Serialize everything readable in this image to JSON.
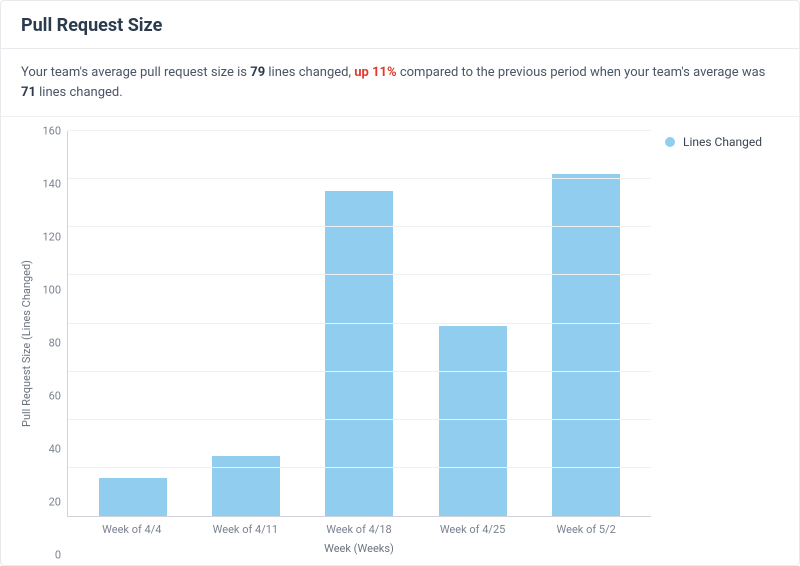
{
  "title": "Pull Request Size",
  "summary": {
    "prefix": "Your team's average pull request size is ",
    "avg_value": "79",
    "mid1": " lines changed, ",
    "change": "up 11%",
    "mid2": " compared to the previous period when your team's average was ",
    "prev_value": "71",
    "suffix": " lines changed."
  },
  "legend": {
    "series_label": "Lines Changed"
  },
  "axes": {
    "ylabel": "Pull Request Size (Lines Changed)",
    "xlabel": "Week (Weeks)"
  },
  "chart_data": {
    "type": "bar",
    "categories": [
      "Week of 4/4",
      "Week of 4/11",
      "Week of 4/18",
      "Week of 4/25",
      "Week of 5/2"
    ],
    "values": [
      16,
      25,
      135,
      79,
      142
    ],
    "title": "Pull Request Size",
    "xlabel": "Week (Weeks)",
    "ylabel": "Pull Request Size (Lines Changed)",
    "ylim": [
      0,
      160
    ],
    "yticks": [
      0,
      20,
      40,
      60,
      80,
      100,
      120,
      140,
      160
    ],
    "series": [
      {
        "name": "Lines Changed",
        "values": [
          16,
          25,
          135,
          79,
          142
        ]
      }
    ]
  }
}
